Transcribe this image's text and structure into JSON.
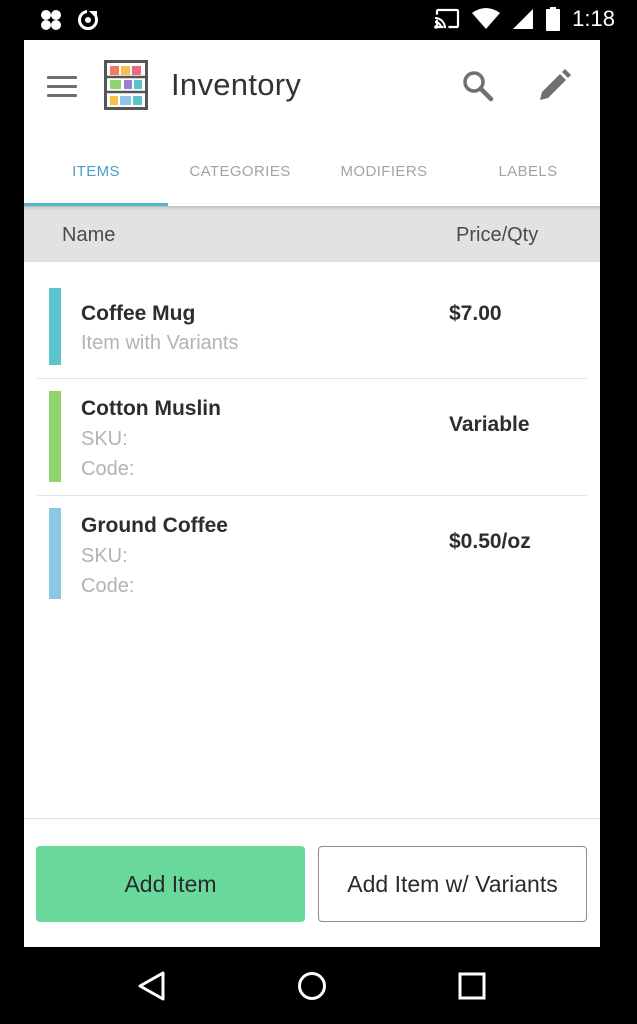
{
  "status_bar": {
    "time": "1:18",
    "icons": [
      "clover-app-icon",
      "sync-icon",
      "cast-icon",
      "wifi-icon",
      "cell-signal-icon",
      "battery-icon"
    ]
  },
  "toolbar": {
    "title": "Inventory",
    "icons": [
      "menu-icon",
      "app-logo",
      "search-icon",
      "edit-pencil-icon"
    ]
  },
  "tabs": [
    {
      "label": "ITEMS",
      "active": true
    },
    {
      "label": "CATEGORIES",
      "active": false
    },
    {
      "label": "MODIFIERS",
      "active": false
    },
    {
      "label": "LABELS",
      "active": false
    }
  ],
  "table": {
    "col_name": "Name",
    "col_price": "Price/Qty"
  },
  "items": [
    {
      "name": "Coffee Mug",
      "sub1": "Item with Variants",
      "price": "$7.00",
      "color": "#5cc4cc"
    },
    {
      "name": "Cotton Muslin",
      "sub1": "SKU:",
      "sub2": "Code:",
      "price": "Variable",
      "color": "#8ed36b"
    },
    {
      "name": "Ground Coffee",
      "sub1": "SKU:",
      "sub2": "Code:",
      "price": "$0.50/oz",
      "color": "#8cc8e6"
    }
  ],
  "footer": {
    "add_item": "Add Item",
    "add_variants": "Add Item w/ Variants"
  },
  "colors": {
    "accent_tab": "#4a9fc2",
    "add_button": "#68d89b",
    "header_bg": "#e1e3e3"
  },
  "nav_bar": {
    "icons": [
      "back-icon",
      "home-icon",
      "recents-icon"
    ]
  }
}
